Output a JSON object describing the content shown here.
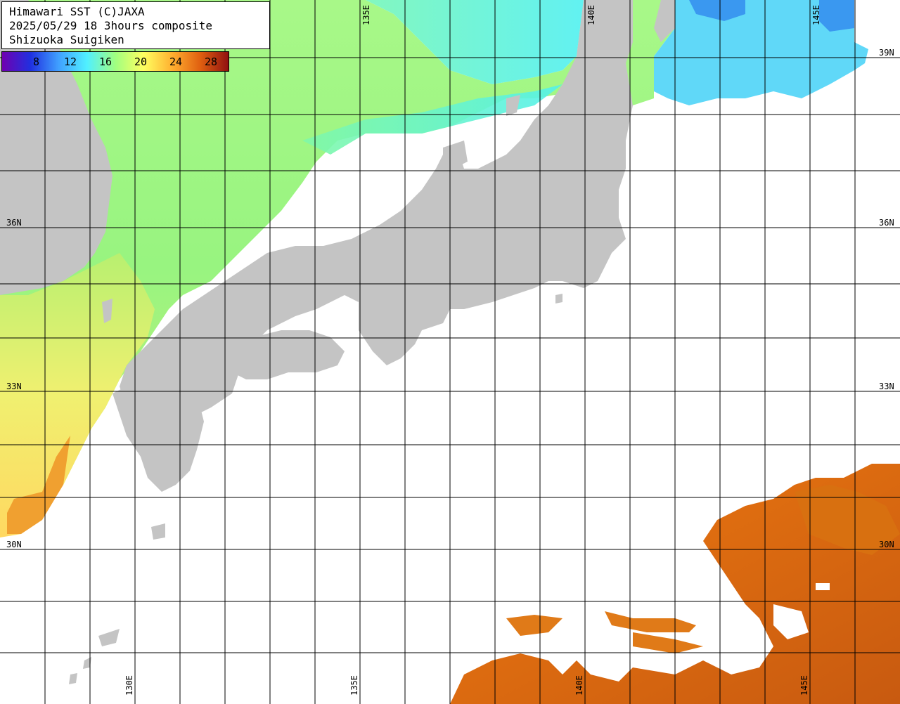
{
  "header": {
    "line1": "Himawari SST (C)JAXA",
    "line2": "2025/05/29 18 3hours composite",
    "line3": "Shizuoka Suigiken"
  },
  "colorbar": {
    "ticks": [
      "8",
      "12",
      "16",
      "20",
      "24",
      "28"
    ],
    "stops": [
      "#7000b0",
      "#2030e0",
      "#40a0ff",
      "#50f0ff",
      "#a0ff80",
      "#ffff60",
      "#ffb030",
      "#e06010",
      "#901010"
    ]
  },
  "lat_labels": {
    "n39": "39N",
    "n36": "36N",
    "n33": "33N",
    "n30": "30N"
  },
  "lon_labels": {
    "e130": "130E",
    "e135": "135E",
    "e140": "140E",
    "e145": "145E"
  },
  "colors": {
    "land": "#c4c4c4",
    "cloud": "#ffffff",
    "sst_cool": "#5cf5dc",
    "sst_mid": "#90f870",
    "sst_warm": "#f0f070",
    "sst_hot": "#d86a10",
    "grid": "#000000"
  }
}
